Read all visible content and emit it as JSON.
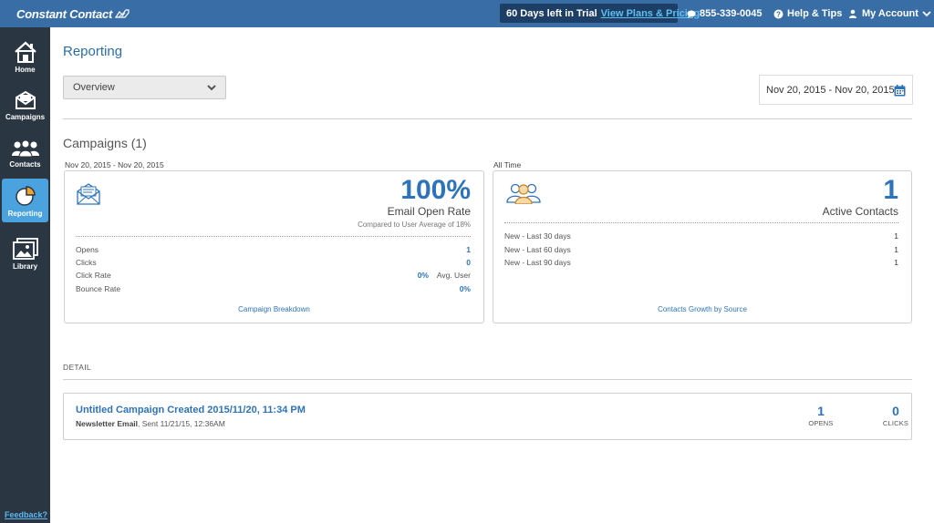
{
  "topbar": {
    "logo": "Constant Contact",
    "trial_days": "60 Days left in Trial",
    "trial_link": "View Plans & Pricing",
    "phone": "855-339-0045",
    "help": "Help & Tips",
    "account": "My Account"
  },
  "sidebar": {
    "items": [
      {
        "label": "Home",
        "icon": "home-icon"
      },
      {
        "label": "Campaigns",
        "icon": "campaigns-icon"
      },
      {
        "label": "Contacts",
        "icon": "contacts-icon"
      },
      {
        "label": "Reporting",
        "icon": "pie-chart-icon",
        "active": true
      },
      {
        "label": "Library",
        "icon": "library-icon"
      }
    ],
    "feedback": "Feedback?"
  },
  "page": {
    "title": "Reporting",
    "view_select": "Overview",
    "date_range": "Nov 20, 2015 - Nov 20, 2015"
  },
  "campaigns": {
    "title": "Campaigns (1)",
    "left_range": "Nov 20, 2015 - Nov 20, 2015",
    "right_range": "All Time",
    "email_card": {
      "big_value": "100%",
      "big_label": "Email Open Rate",
      "compare": "Compared to User Average of 18%",
      "rows": [
        {
          "label": "Opens",
          "value": "1"
        },
        {
          "label": "Clicks",
          "value": "0"
        },
        {
          "label": "Click Rate",
          "value": "0%",
          "extra": "Avg. User"
        },
        {
          "label": "Bounce Rate",
          "value": "0%"
        }
      ],
      "link": "Campaign Breakdown"
    },
    "contacts_card": {
      "big_value": "1",
      "big_label": "Active Contacts",
      "rows": [
        {
          "label": "New - Last 30 days",
          "value": "1"
        },
        {
          "label": "New - Last 60 days",
          "value": "1"
        },
        {
          "label": "New - Last 90 days",
          "value": "1"
        }
      ],
      "link": "Contacts Growth by Source"
    }
  },
  "detail": {
    "label": "DETAIL",
    "campaign_title": "Untitled Campaign Created 2015/11/20, 11:34 PM",
    "campaign_type": "Newsletter Email",
    "campaign_sent": ", Sent 11/21/15, 12:36AM",
    "opens_value": "1",
    "opens_label": "OPENS",
    "clicks_value": "0",
    "clicks_label": "CLICKS"
  },
  "colors": {
    "topbar": "#386da6",
    "sidebar": "#2b3643",
    "accent": "#2e73b8",
    "active_nav": "#4aa3df"
  }
}
